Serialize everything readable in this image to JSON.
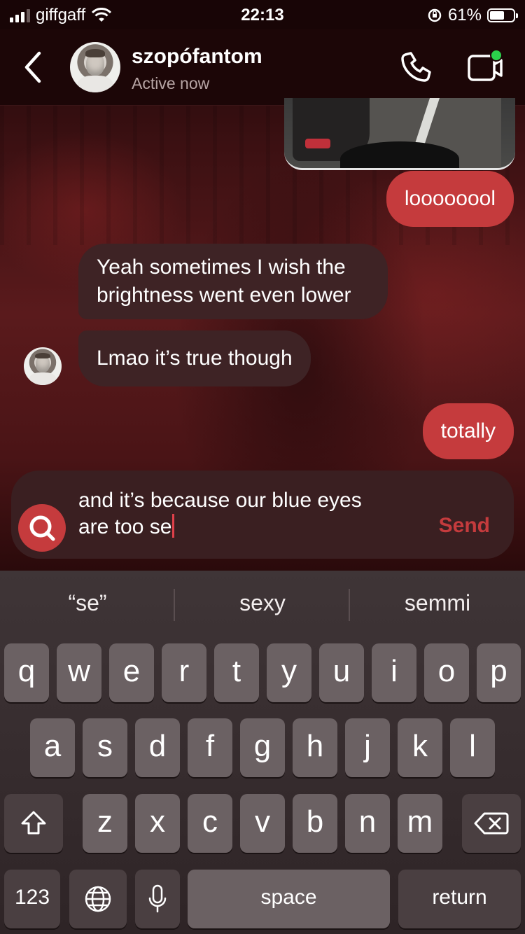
{
  "status_bar": {
    "carrier": "giffgaff",
    "time": "22:13",
    "battery_percent": "61%",
    "battery_level": 0.61
  },
  "header": {
    "contact_name": "szopófantom",
    "contact_status": "Active now"
  },
  "messages": [
    {
      "side": "sent",
      "text": "loooooool"
    },
    {
      "side": "received",
      "text": "Yeah sometimes I wish the brightness went even lower"
    },
    {
      "side": "received",
      "text": "Lmao it’s true though"
    },
    {
      "side": "sent",
      "text": "totally"
    }
  ],
  "composer": {
    "text_line_1": "and it’s because our blue eyes",
    "text_line_2": "are too se",
    "send_label": "Send"
  },
  "keyboard": {
    "suggestions": [
      "“se”",
      "sexy",
      "semmi"
    ],
    "row1": [
      "q",
      "w",
      "e",
      "r",
      "t",
      "y",
      "u",
      "i",
      "o",
      "p"
    ],
    "row2": [
      "a",
      "s",
      "d",
      "f",
      "g",
      "h",
      "j",
      "k",
      "l"
    ],
    "row3": [
      "z",
      "x",
      "c",
      "v",
      "b",
      "n",
      "m"
    ],
    "numbers_label": "123",
    "space_label": "space",
    "return_label": "return"
  },
  "colors": {
    "accent": "#c53b3d",
    "received_bubble": "#3e2325",
    "online": "#2bd24b"
  }
}
